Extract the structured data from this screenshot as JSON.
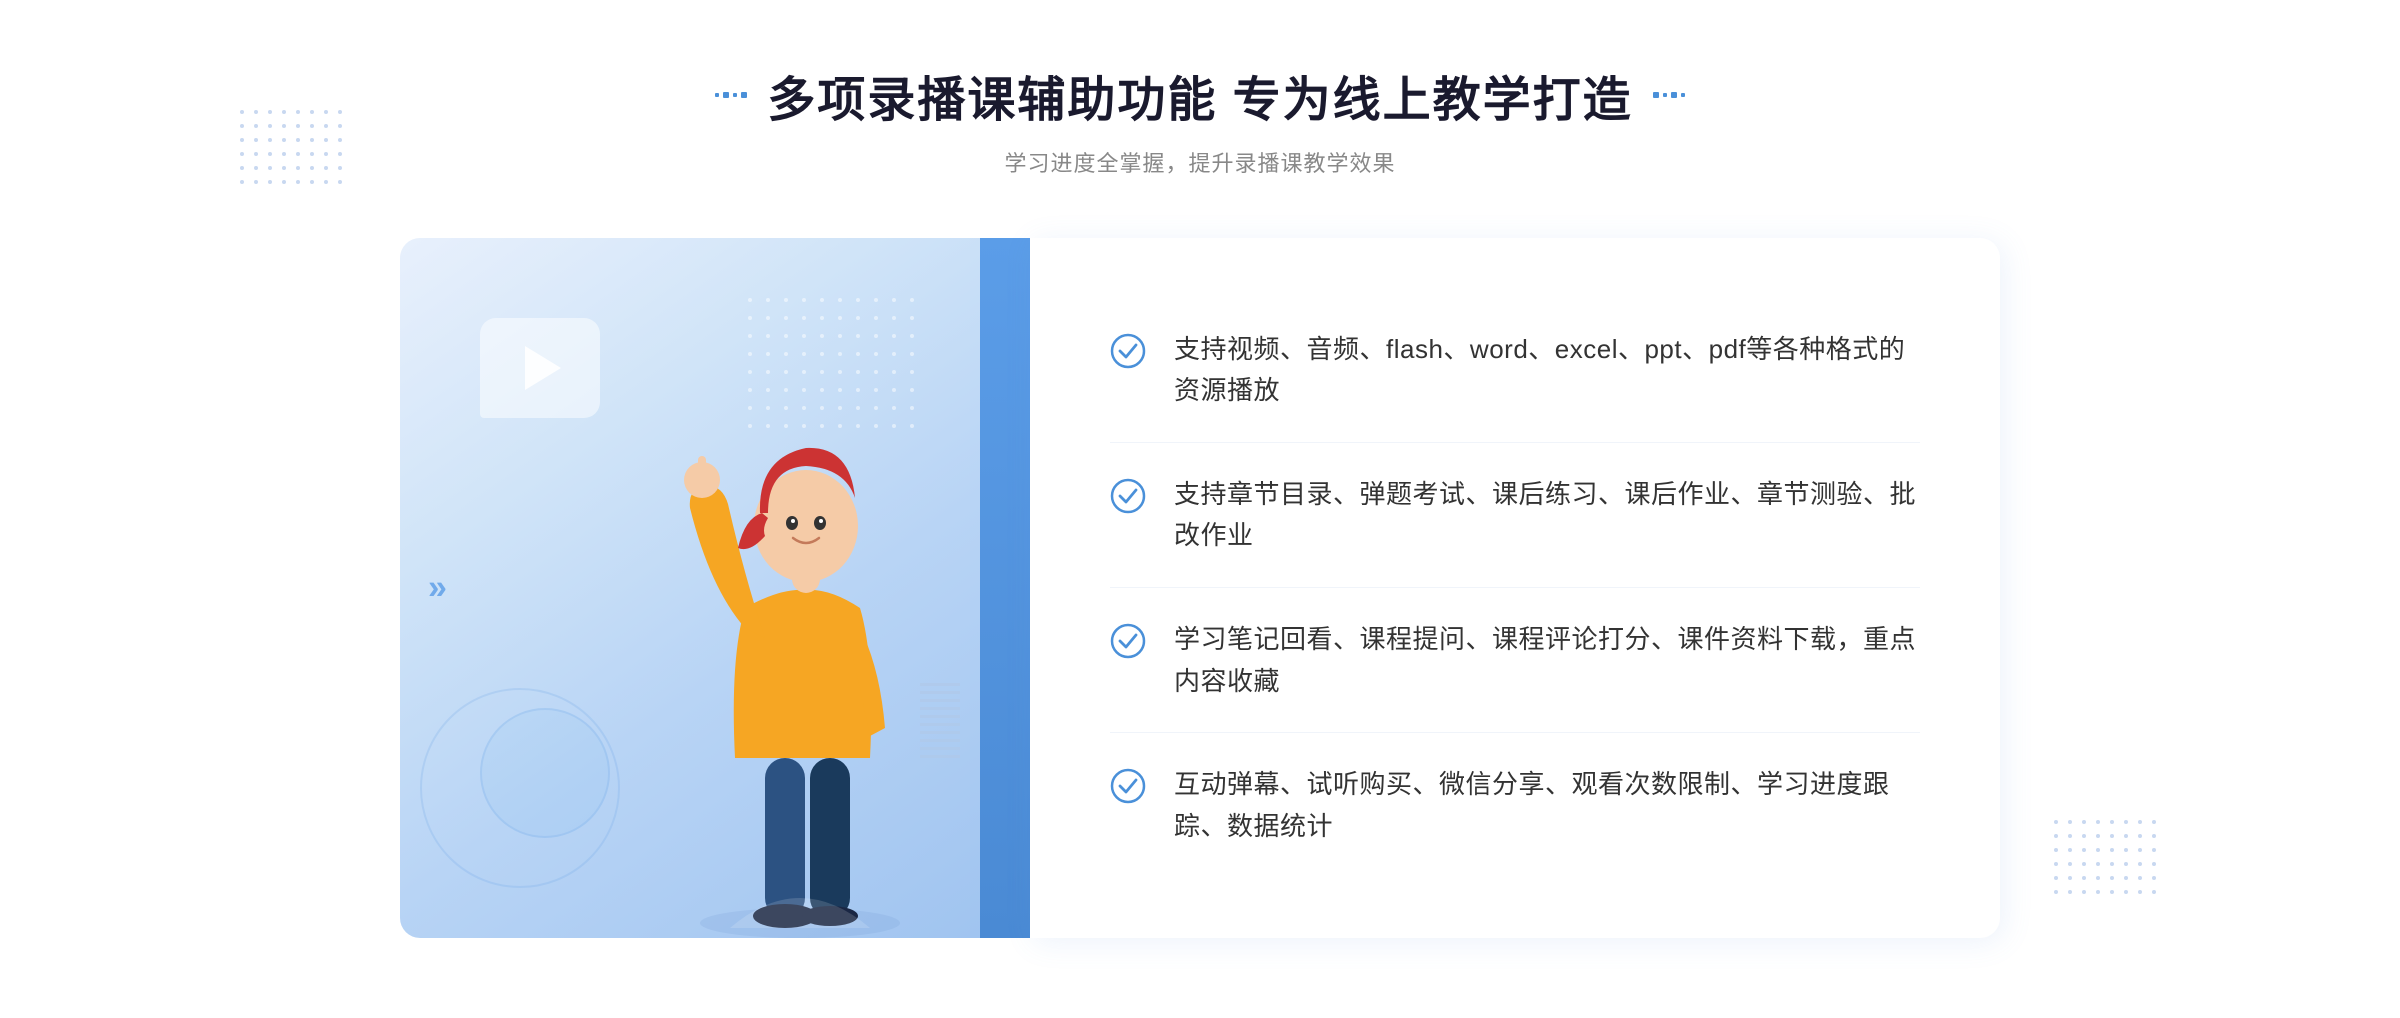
{
  "page": {
    "background": "#ffffff"
  },
  "header": {
    "title": "多项录播课辅助功能 专为线上教学打造",
    "subtitle": "学习进度全掌握，提升录播课教学效果",
    "decoration_left": "decorative-dots-left",
    "decoration_right": "decorative-dots-right"
  },
  "features": [
    {
      "id": 1,
      "text": "支持视频、音频、flash、word、excel、ppt、pdf等各种格式的资源播放"
    },
    {
      "id": 2,
      "text": "支持章节目录、弹题考试、课后练习、课后作业、章节测验、批改作业"
    },
    {
      "id": 3,
      "text": "学习笔记回看、课程提问、课程评论打分、课件资料下载，重点内容收藏"
    },
    {
      "id": 4,
      "text": "互动弹幕、试听购买、微信分享、观看次数限制、学习进度跟踪、数据统计"
    }
  ],
  "colors": {
    "primary_blue": "#4a8ad4",
    "light_blue": "#5b9de8",
    "check_color": "#4a90d9",
    "title_color": "#1a1a2e",
    "subtitle_color": "#888888",
    "feature_text_color": "#333333"
  }
}
